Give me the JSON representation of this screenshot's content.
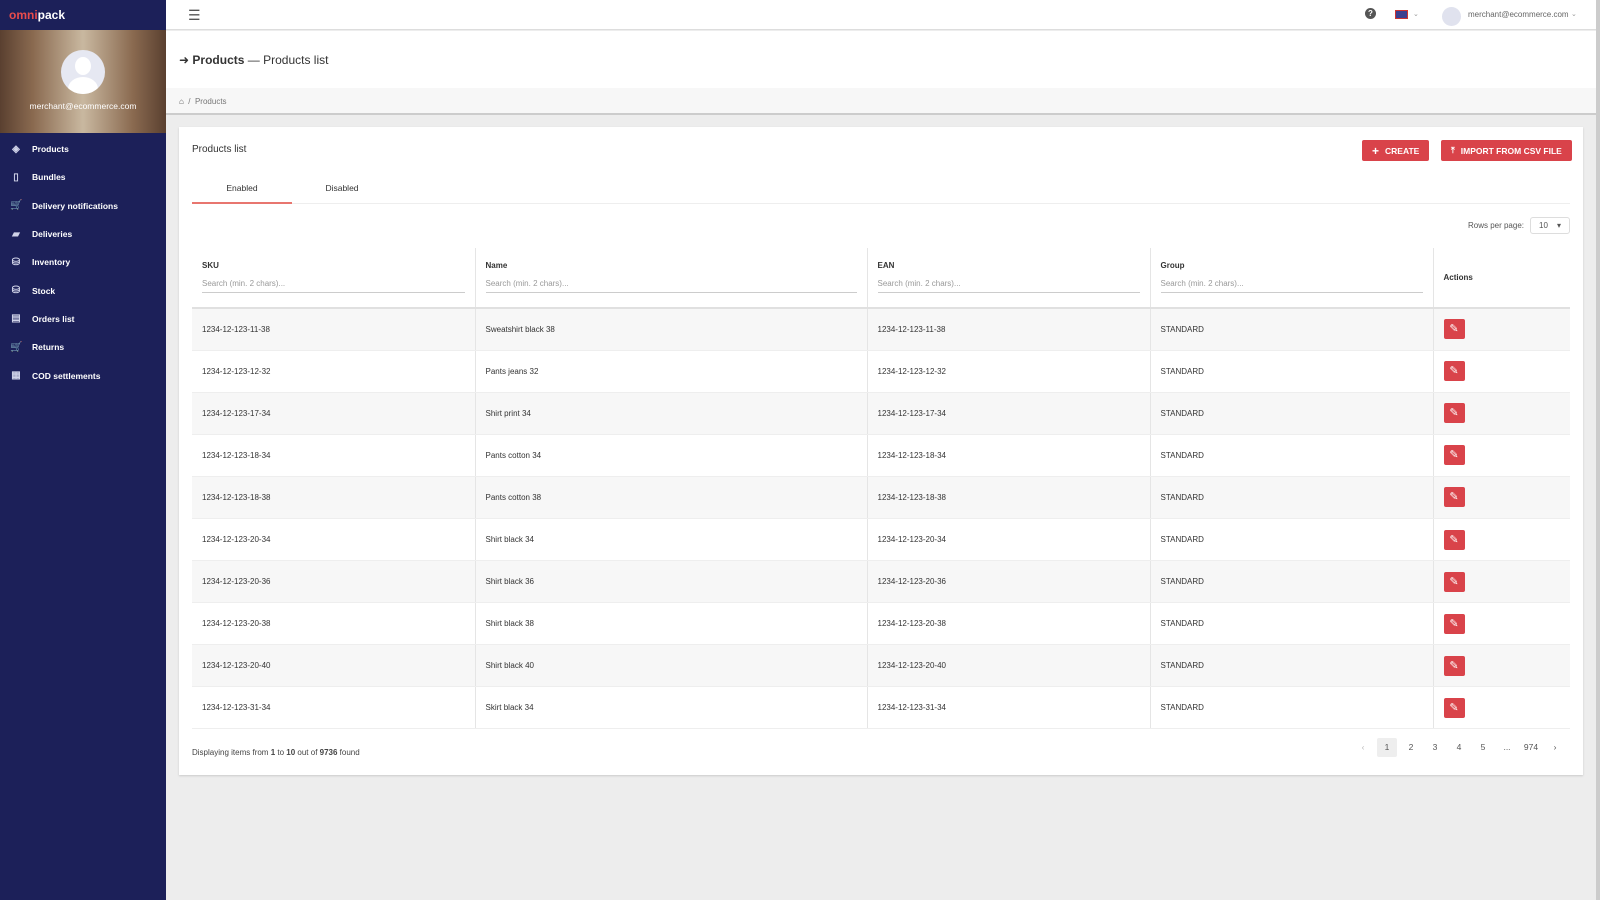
{
  "brand": {
    "part1": "omni",
    "part2": "pack"
  },
  "user": {
    "email": "merchant@ecommerce.com"
  },
  "sidebar": {
    "items": [
      {
        "label": "Products",
        "icon": "layers-icon"
      },
      {
        "label": "Bundles",
        "icon": "bundle-icon"
      },
      {
        "label": "Delivery notifications",
        "icon": "cart-icon"
      },
      {
        "label": "Deliveries",
        "icon": "truck-icon"
      },
      {
        "label": "Inventory",
        "icon": "inventory-icon"
      },
      {
        "label": "Stock",
        "icon": "stock-icon"
      },
      {
        "label": "Orders list",
        "icon": "list-icon"
      },
      {
        "label": "Returns",
        "icon": "cart-icon"
      },
      {
        "label": "COD settlements",
        "icon": "grid-icon"
      }
    ]
  },
  "header": {
    "title_bold": "Products",
    "title_rest": " — Products list",
    "breadcrumb": "Products"
  },
  "card": {
    "title": "Products list",
    "create": "CREATE",
    "import": "IMPORT FROM CSV FILE",
    "tabs": [
      "Enabled",
      "Disabled"
    ],
    "rows_per_page_label": "Rows per page:",
    "rows_per_page": "10"
  },
  "table": {
    "columns": [
      "SKU",
      "Name",
      "EAN",
      "Group",
      "Actions"
    ],
    "search_placeholder": "Search (min. 2 chars)...",
    "rows": [
      [
        "1234-12-123-11-38",
        "Sweatshirt black 38",
        "1234-12-123-11-38",
        "STANDARD"
      ],
      [
        "1234-12-123-12-32",
        "Pants jeans 32",
        "1234-12-123-12-32",
        "STANDARD"
      ],
      [
        "1234-12-123-17-34",
        "Shirt print 34",
        "1234-12-123-17-34",
        "STANDARD"
      ],
      [
        "1234-12-123-18-34",
        "Pants cotton 34",
        "1234-12-123-18-34",
        "STANDARD"
      ],
      [
        "1234-12-123-18-38",
        "Pants cotton 38",
        "1234-12-123-18-38",
        "STANDARD"
      ],
      [
        "1234-12-123-20-34",
        "Shirt black 34",
        "1234-12-123-20-34",
        "STANDARD"
      ],
      [
        "1234-12-123-20-36",
        "Shirt black 36",
        "1234-12-123-20-36",
        "STANDARD"
      ],
      [
        "1234-12-123-20-38",
        "Shirt black 38",
        "1234-12-123-20-38",
        "STANDARD"
      ],
      [
        "1234-12-123-20-40",
        "Shirt black 40",
        "1234-12-123-20-40",
        "STANDARD"
      ],
      [
        "1234-12-123-31-34",
        "Skirt black 34",
        "1234-12-123-31-34",
        "STANDARD"
      ]
    ]
  },
  "footer": {
    "prefix": "Displaying items from ",
    "from": "1",
    "to_word": " to ",
    "to": "10",
    "out_word": " out of ",
    "total": "9736",
    "suffix": " found"
  },
  "pager": {
    "pages": [
      "1",
      "2",
      "3",
      "4",
      "5",
      "...",
      "974"
    ],
    "current": "1"
  }
}
